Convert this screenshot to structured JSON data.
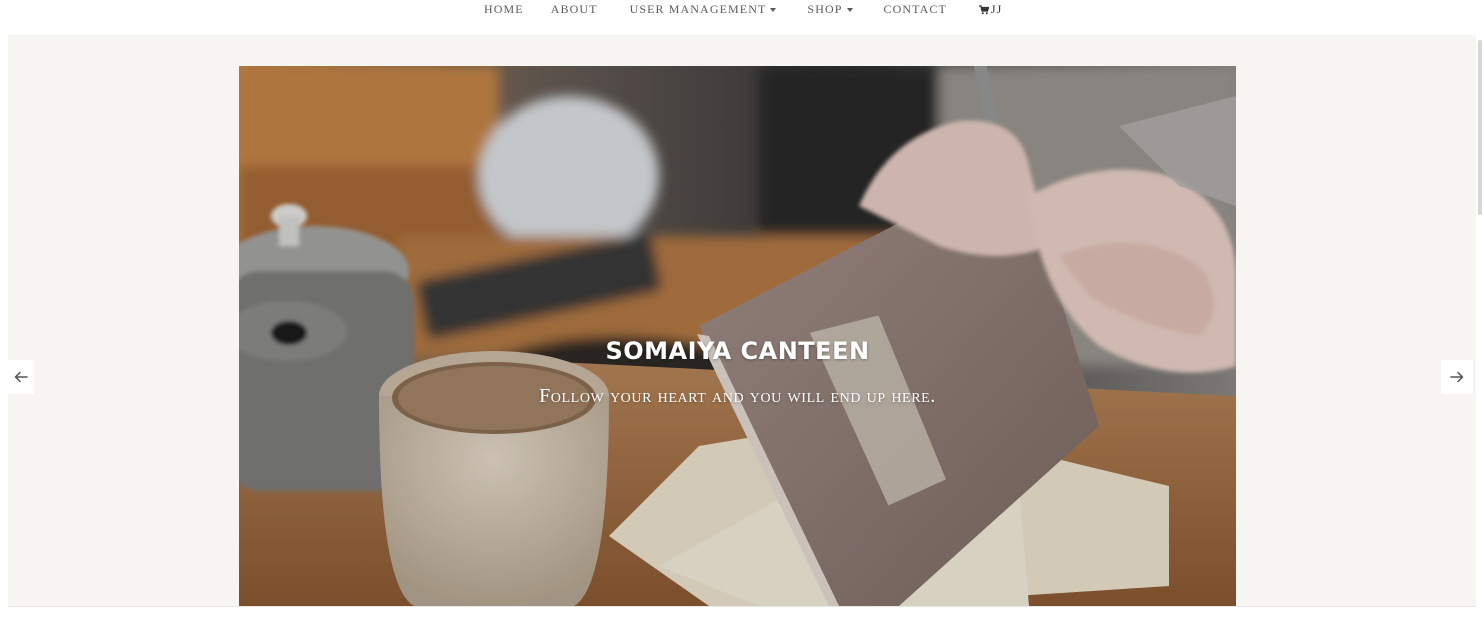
{
  "nav": {
    "home": "Home",
    "about": "About",
    "user_management": "User Management",
    "shop": "Shop",
    "contact": "Contact",
    "cart_label": "JJ"
  },
  "hero": {
    "title": "SOMAIYA CANTEEN",
    "subtitle": "Follow your heart and you will end up here.",
    "prev_icon": "arrow-left-icon",
    "next_icon": "arrow-right-icon"
  },
  "colors": {
    "nav_text": "#5a5a5a",
    "hero_background": "#f6f5f1",
    "caption_text": "#ffffff"
  }
}
